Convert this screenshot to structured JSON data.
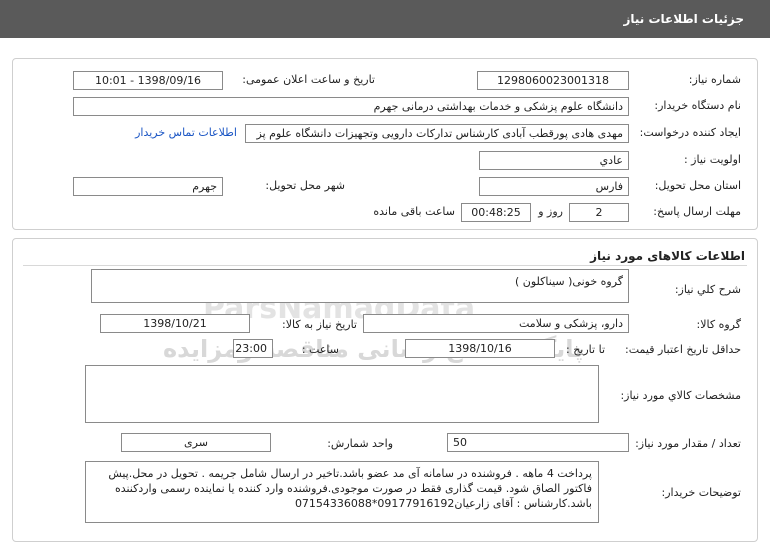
{
  "header": {
    "title": "جزئیات اطلاعات نیاز"
  },
  "need": {
    "need_number_label": "شماره نیاز:",
    "need_number": "1298060023001318",
    "announce_label": "تاریخ و ساعت اعلان عمومی:",
    "announce_value": "1398/09/16 - 10:01",
    "buyer_label": "نام دستگاه خریدار:",
    "buyer_value": "دانشگاه علوم پزشکی و خدمات بهداشتی درمانی جهرم",
    "creator_label": "ایجاد کننده درخواست:",
    "creator_value": "مهدی هادی پورقطب آبادی کارشناس تدارکات دارویی وتجهیزات دانشگاه علوم پز",
    "contact_link": "اطلاعات تماس خریدار",
    "priority_label": "اولویت نیاز :",
    "priority_value": "عادي",
    "province_label": "استان محل تحویل:",
    "province_value": "فارس",
    "city_label": "شهر محل تحویل:",
    "city_value": "جهرم",
    "deadline_label": "مهلت ارسال پاسخ:",
    "deadline_days": "2",
    "days_text": "روز و",
    "deadline_time": "00:48:25",
    "remaining_text": "ساعت باقی مانده"
  },
  "goods": {
    "section_title": "اطلاعات کالاهای مورد نیاز",
    "desc_label": "شرح کلي نیاز:",
    "desc_value": "گروه خونی( سیناکلون )",
    "group_label": "گروه کالا:",
    "group_value": "دارو، پزشکی و سلامت",
    "need_date_label": "تاریخ نیاز به کالا:",
    "need_date_value": "1398/10/21",
    "min_price_label": "حداقل تاریخ اعتبار قیمت:",
    "until_date_label": "تا تاریخ :",
    "until_date_value": "1398/10/16",
    "time_label": "ساعت :",
    "time_value": "23:00",
    "specs_label": "مشخصات کالاي مورد نیاز:",
    "specs_value": "",
    "qty_label": "تعداد / مقدار مورد نیاز:",
    "qty_value": "50",
    "unit_label": "واحد شمارش:",
    "unit_value": "سری",
    "notes_label": "توضیحات خریدار:",
    "notes_value": "پرداخت 4 ماهه . فروشنده در سامانه آی مد عضو باشد.تاخیر در ارسال شامل جریمه  . تحویل در محل.پیش فاکتور الصاق شود. قیمت گذاری فقط در صورت موجودی.فروشنده وارد کننده یا نماینده رسمی واردکننده باشد.کارشناس : آقای زارعیان09177916192*07154336088"
  },
  "watermark": {
    "brand_en": "ParsNamadData",
    "brand_fa": "پایگاه اطلاع رسانی مناقصه ومزایده",
    "phone": "۰۲۱-۸۸۳۴۹۶۷۰-۵"
  }
}
